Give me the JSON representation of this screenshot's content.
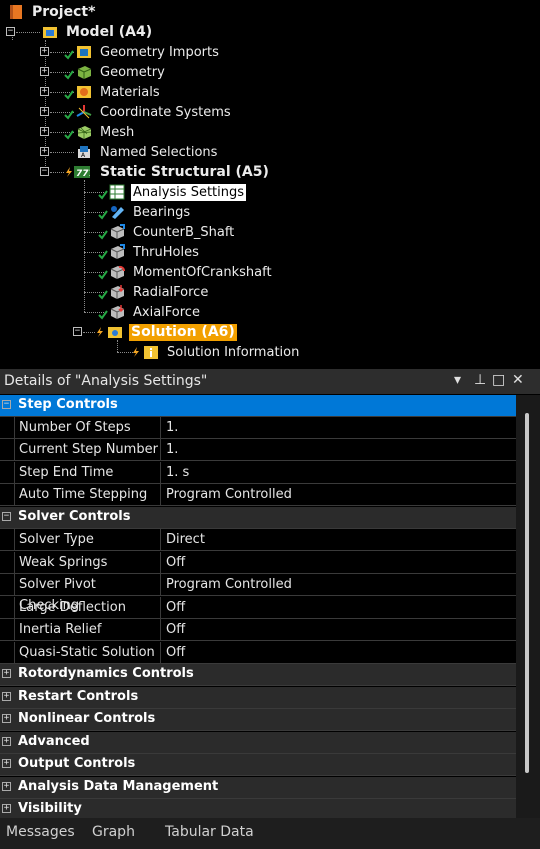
{
  "tree": {
    "project": "Project*",
    "model": "Model (A4)",
    "items": [
      {
        "label": "Geometry Imports"
      },
      {
        "label": "Geometry"
      },
      {
        "label": "Materials"
      },
      {
        "label": "Coordinate Systems"
      },
      {
        "label": "Mesh"
      },
      {
        "label": "Named Selections"
      }
    ],
    "analysis": "Static Structural (A5)",
    "analysis_items": [
      {
        "label": "Analysis Settings"
      },
      {
        "label": "Bearings"
      },
      {
        "label": "CounterB_Shaft"
      },
      {
        "label": "ThruHoles"
      },
      {
        "label": "MomentOfCrankshaft"
      },
      {
        "label": "RadialForce"
      },
      {
        "label": "AxialForce"
      }
    ],
    "solution": "Solution (A6)",
    "solution_info": "Solution Information"
  },
  "details": {
    "title": "Details of \"Analysis Settings\"",
    "buttons": {
      "dropdown": "▾",
      "pin": "⊥",
      "maximize": "□",
      "close": "✕"
    },
    "categories": [
      {
        "label": "Step Controls",
        "expanded": true
      },
      {
        "label": "Solver Controls",
        "expanded": true
      },
      {
        "label": "Rotordynamics Controls",
        "expanded": false
      },
      {
        "label": "Restart Controls",
        "expanded": false
      },
      {
        "label": "Nonlinear Controls",
        "expanded": false
      },
      {
        "label": "Advanced",
        "expanded": false
      },
      {
        "label": "Output Controls",
        "expanded": false
      },
      {
        "label": "Analysis Data Management",
        "expanded": false
      },
      {
        "label": "Visibility",
        "expanded": false
      }
    ],
    "step_controls": [
      {
        "name": "Number Of Steps",
        "value": "1."
      },
      {
        "name": "Current Step Number",
        "value": "1."
      },
      {
        "name": "Step End Time",
        "value": "1. s"
      },
      {
        "name": "Auto Time Stepping",
        "value": "Program Controlled"
      }
    ],
    "solver_controls": [
      {
        "name": "Solver Type",
        "value": "Direct"
      },
      {
        "name": "Weak Springs",
        "value": "Off"
      },
      {
        "name": "Solver Pivot Checking",
        "value": "Program Controlled"
      },
      {
        "name": "Large Deflection",
        "value": "Off"
      },
      {
        "name": "Inertia Relief",
        "value": "Off"
      },
      {
        "name": "Quasi-Static Solution",
        "value": "Off"
      }
    ]
  },
  "tabs": [
    {
      "label": "Messages"
    },
    {
      "label": "Graph"
    },
    {
      "label": "Tabular Data"
    }
  ],
  "colors": {
    "selection": "#0078d7",
    "solution_highlight": "#f2a000",
    "check": "#27a844",
    "lightning": "#f5a623"
  }
}
